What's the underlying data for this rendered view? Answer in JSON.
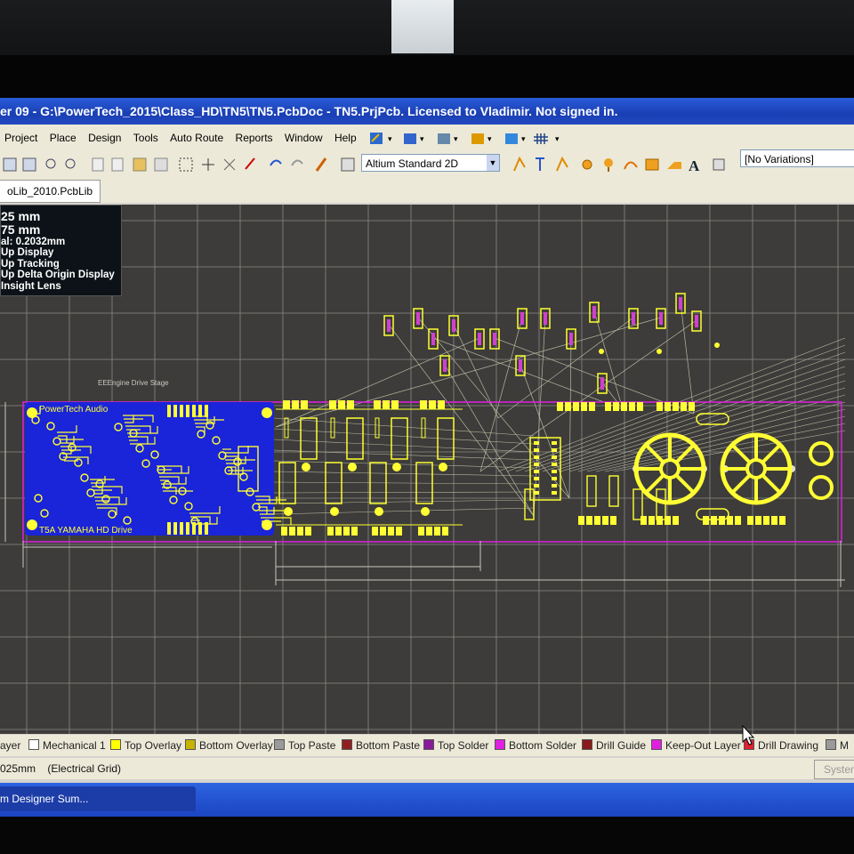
{
  "window": {
    "title": "er 09 - G:\\PowerTech_2015\\Class_HD\\TN5\\TN5.PcbDoc - TN5.PrjPcb. Licensed to Vladimir. Not signed in."
  },
  "menu": {
    "items": [
      "Project",
      "Place",
      "Design",
      "Tools",
      "Auto Route",
      "Reports",
      "Window",
      "Help"
    ]
  },
  "toolbar": {
    "view_mode": "Altium Standard 2D",
    "variations": "[No Variations]"
  },
  "doc_tab": {
    "label": "oLib_2010.PcbLib"
  },
  "hud": {
    "line1": "25  mm",
    "line2": "75  mm",
    "line3": "al: 0.2032mm",
    "line4": "Up Display",
    "line5": "Up Tracking",
    "line6": "Up Delta Origin Display",
    "line7": "Insight Lens"
  },
  "board": {
    "title_label": "EEEngine Drive Stage",
    "top_text": "PowerTech Audio",
    "bottom_text": "T5A  YAMAHA HD Drive"
  },
  "layers": [
    {
      "label": "ayer",
      "color": "#d6d3ce",
      "active": true
    },
    {
      "label": "Mechanical 1",
      "color": "#ffffff"
    },
    {
      "label": "Top Overlay",
      "color": "#ffff00"
    },
    {
      "label": "Bottom Overlay",
      "color": "#c8b400"
    },
    {
      "label": "Top Paste",
      "color": "#9a9a9a"
    },
    {
      "label": "Bottom Paste",
      "color": "#902020"
    },
    {
      "label": "Top Solder",
      "color": "#8a1a9a"
    },
    {
      "label": "Bottom Solder",
      "color": "#e020e0"
    },
    {
      "label": "Drill Guide",
      "color": "#8a1a1a"
    },
    {
      "label": "Keep-Out Layer",
      "color": "#e020e0"
    },
    {
      "label": "Drill Drawing",
      "color": "#e02030"
    },
    {
      "label": "M",
      "color": "#9a9a9a"
    }
  ],
  "status": {
    "grid": "025mm",
    "grid_type": "(Electrical Grid)",
    "system": "System"
  },
  "taskbar": {
    "item": "m Designer Sum..."
  },
  "colors": {
    "canvas": "#3d3c3a",
    "grid": "#8a8a86",
    "overlay": "#ffff33",
    "bottom_copper": "#1a24d8",
    "keepout": "#e020e0",
    "ratsnest": "#b8b8a0"
  }
}
